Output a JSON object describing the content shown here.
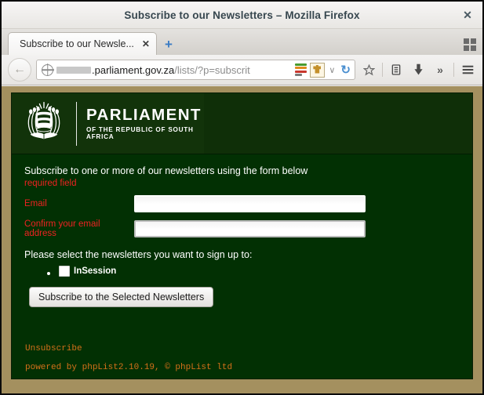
{
  "window": {
    "title": "Subscribe to our Newsletters – Mozilla Firefox",
    "close_label": "✕"
  },
  "tabbar": {
    "tab_label": "Subscribe to our Newsle...",
    "tab_close": "✕",
    "new_tab": "+",
    "list_all_tabs_icon": "grid-icon"
  },
  "navbar": {
    "back_arrow": "←",
    "url_prefix_redacted": "",
    "url_host": ".parliament.gov.za",
    "url_path": "/lists/?p=subscrit",
    "reload": "↻",
    "chevron": "∨",
    "overflow": "»",
    "menu": "☰"
  },
  "page": {
    "banner": {
      "brand_main": "PARLIAMENT",
      "brand_sub": "OF THE REPUBLIC OF SOUTH AFRICA",
      "crest_alt": "south-africa-coat-of-arms"
    },
    "intro": "Subscribe to one or more of our newsletters using the form below",
    "required_note": "required field",
    "fields": [
      {
        "label": "Email",
        "value": "",
        "placeholder": "",
        "focused": true
      },
      {
        "label": "Confirm your email address",
        "value": "",
        "placeholder": "",
        "focused": false
      }
    ],
    "select_prompt": "Please select the newsletters you want to sign up to:",
    "newsletters": [
      {
        "label": "InSession",
        "checked": false
      }
    ],
    "submit_label": "Subscribe to the Selected Newsletters",
    "footer": {
      "unsubscribe": "Unsubscribe",
      "powered_by": "powered by phpList2.10.19, © phpList ltd"
    }
  },
  "colors": {
    "page_bg": "#023003",
    "banner_bg": "#12330a",
    "border_tan": "#a4905f",
    "required_red": "#ee2222",
    "footer_orange": "#d4701a"
  }
}
